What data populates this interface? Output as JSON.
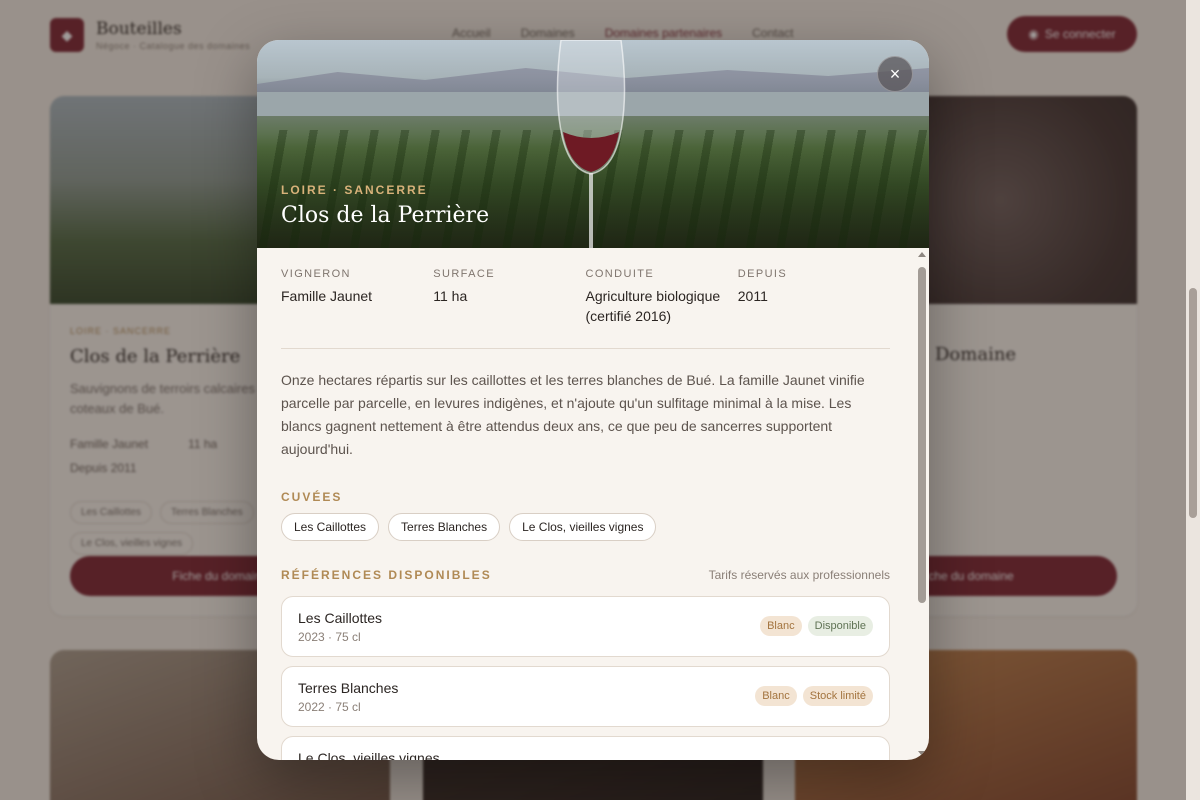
{
  "background": {
    "brand": {
      "name": "Bouteilles",
      "tagline": "Négoce · Catalogue des domaines"
    },
    "nav": [
      "Accueil",
      "Domaines",
      "Domaines partenaires",
      "Contact"
    ],
    "cta": "Se connecter",
    "card_left": {
      "region": "LOIRE · SANCERRE",
      "title": "Clos de la Perrière",
      "text": "Sauvignons de terroirs calcaires et silex, sur les coteaux de Bué.",
      "meta": [
        "Famille Jaunet",
        "11 ha",
        "Depuis 2011"
      ],
      "tags": [
        "Les Caillottes",
        "Terres Blanches",
        "Le Clos, vieilles vignes"
      ],
      "button": "Fiche du domaine"
    },
    "card_right": {
      "title": "Domaine",
      "button": "Fiche du domaine"
    }
  },
  "modal": {
    "close_label": "×",
    "region": "LOIRE · SANCERRE",
    "title": "Clos de la Perrière",
    "facts": [
      {
        "label": "VIGNERON",
        "value": "Famille Jaunet"
      },
      {
        "label": "SURFACE",
        "value": "11 ha"
      },
      {
        "label": "CONDUITE",
        "value": "Agriculture biologique (certifié 2016)"
      },
      {
        "label": "DEPUIS",
        "value": "2011"
      }
    ],
    "description": "Onze hectares répartis sur les caillottes et les terres blanches de Bué. La famille Jaunet vinifie parcelle par parcelle, en levures indigènes, et n'ajoute qu'un sulfitage minimal à la mise. Les blancs gagnent nettement à être attendus deux ans, ce que peu de sancerres supportent aujourd'hui.",
    "cuvees_title": "CUVÉES",
    "cuvees": [
      "Les Caillottes",
      "Terres Blanches",
      "Le Clos, vieilles vignes"
    ],
    "refs_title": "RÉFÉRENCES DISPONIBLES",
    "refs_note": "Tarifs réservés aux professionnels",
    "references": [
      {
        "name": "Les Caillottes",
        "sub": "2023 · 75 cl",
        "color": "Blanc",
        "status": "Disponible"
      },
      {
        "name": "Terres Blanches",
        "sub": "2022 · 75 cl",
        "color": "Blanc",
        "status": "Stock limité"
      },
      {
        "name": "Le Clos, vieilles vignes",
        "sub": "",
        "color": "",
        "status": ""
      }
    ]
  },
  "colors": {
    "accent": "#7a1f2e",
    "gold": "#b08a55",
    "modal_bg": "#f8f4ef"
  }
}
